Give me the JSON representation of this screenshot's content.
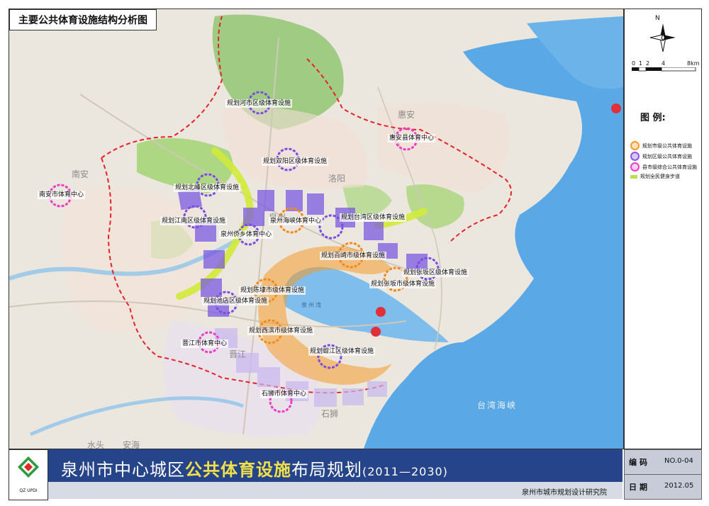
{
  "map": {
    "title": "主要公共体育设施结构分析图",
    "labels": [
      {
        "id": "hecheng",
        "text": "规划河市区级体育设施"
      },
      {
        "id": "shuangyang",
        "text": "规划双阳区级体育设施"
      },
      {
        "id": "beifeng",
        "text": "规划北峰区级体育设施"
      },
      {
        "id": "jiangnan",
        "text": "规划江南区级体育设施"
      },
      {
        "id": "qiaoxiang",
        "text": "泉州侨乡体育中心"
      },
      {
        "id": "haixia",
        "text": "泉州海峡体育中心"
      },
      {
        "id": "taishang",
        "text": "规划台湾区级体育设施"
      },
      {
        "id": "baiqi",
        "text": "规划百崎市级体育设施"
      },
      {
        "id": "zhangban-district",
        "text": "规划张坂区级体育设施"
      },
      {
        "id": "zhangban-city",
        "text": "规划张坂市级体育设施"
      },
      {
        "id": "chendai",
        "text": "规划陈埭市级体育设施"
      },
      {
        "id": "chidian",
        "text": "规划池店区级体育设施"
      },
      {
        "id": "xibin",
        "text": "规划西滨市级体育设施"
      },
      {
        "id": "ganjiang",
        "text": "规划蚶江区级体育设施"
      },
      {
        "id": "jinjiang",
        "text": "晋江市体育中心"
      },
      {
        "id": "shishi",
        "text": "石狮市体育中心"
      },
      {
        "id": "nanan",
        "text": "南安市体育中心"
      },
      {
        "id": "huian",
        "text": "惠安县体育中心"
      }
    ],
    "places": [
      "惠安",
      "南安",
      "泉州",
      "晋江",
      "石狮",
      "洛阳",
      "安海",
      "水头"
    ],
    "sea_labels": [
      "泉州湾",
      "台湾海峡"
    ]
  },
  "legend": {
    "north": "N",
    "scale": [
      "0",
      "1",
      "2",
      "4",
      "8km"
    ],
    "title": "图 例:",
    "items": [
      {
        "label": "规划市级公共体育设施",
        "color": "#f59a2b"
      },
      {
        "label": "规划区级公共体育设施",
        "color": "#8a55e0"
      },
      {
        "label": "县市级综合公共体育设施",
        "color": "#ee3cc4"
      },
      {
        "label": "规划全民健身步道",
        "color": "#b8e04a"
      }
    ]
  },
  "footer": {
    "logo_text": "QZ UPDI",
    "title_prefix": "泉州市中心城区",
    "title_highlight": "公共体育设施",
    "title_suffix": "布局规划",
    "title_years": "(2011—2030)",
    "institute": "泉州市城市规划设计研究院",
    "code_key": "编码",
    "code_value": "NO.0-04",
    "date_key": "日期",
    "date_value": "2012.05"
  }
}
